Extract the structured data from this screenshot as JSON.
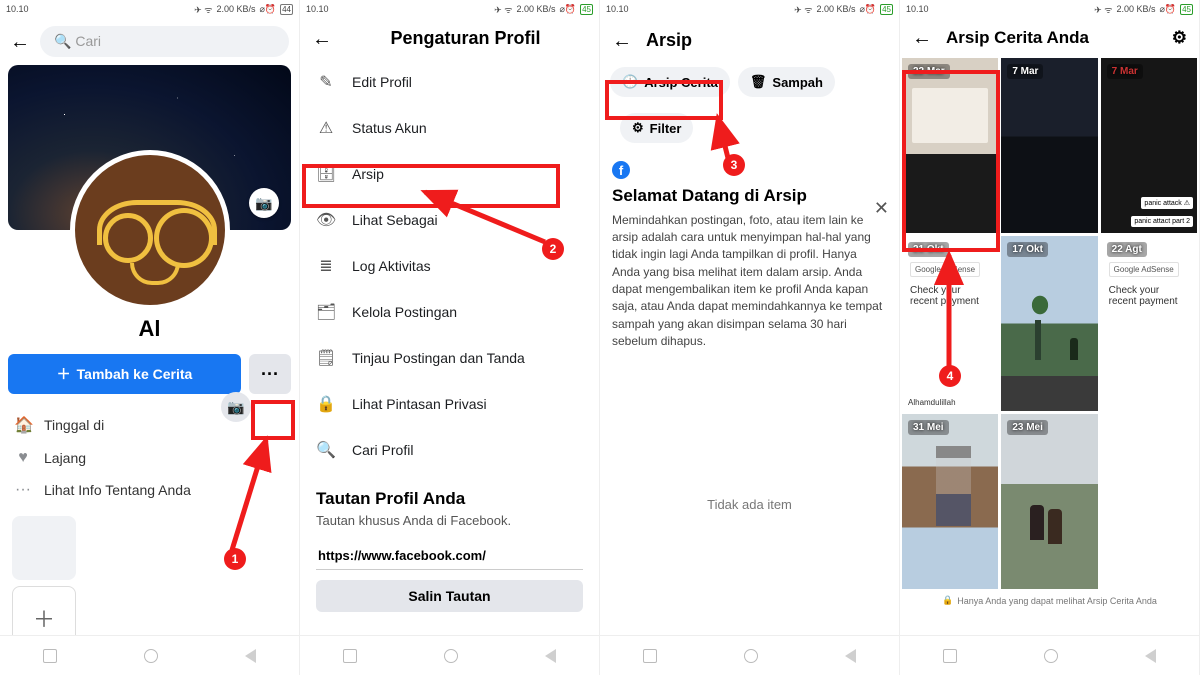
{
  "status": {
    "time": "10.10",
    "battery_p1": "44",
    "battery": "45",
    "net": "2.00 KB/s"
  },
  "panel1": {
    "search_placeholder": "Cari",
    "username": "Al",
    "add_story": "Tambah ke Cerita",
    "info": {
      "lives": "Tinggal di",
      "relation": "Lajang",
      "about": "Lihat Info Tentang Anda"
    }
  },
  "panel2": {
    "title": "Pengaturan Profil",
    "items": {
      "edit": "Edit Profil",
      "status": "Status Akun",
      "archive": "Arsip",
      "viewas": "Lihat Sebagai",
      "activity": "Log Aktivitas",
      "manage": "Kelola Postingan",
      "review": "Tinjau Postingan dan Tanda",
      "privacy": "Lihat Pintasan Privasi",
      "search": "Cari Profil"
    },
    "link_section": {
      "heading": "Tautan Profil Anda",
      "sub": "Tautan khusus Anda di Facebook.",
      "url": "https://www.facebook.com/",
      "copy": "Salin Tautan"
    }
  },
  "panel3": {
    "title": "Arsip",
    "chip_story": "Arsip Cerita",
    "chip_trash": "Sampah",
    "chip_filter": "Filter",
    "welcome_title": "Selamat Datang di Arsip",
    "welcome_body": "Memindahkan postingan, foto, atau item lain ke arsip adalah cara untuk menyimpan hal-hal yang tidak ingin lagi Anda tampilkan di profil. Hanya Anda yang bisa melihat item dalam arsip. Anda dapat mengembalikan item ke profil Anda kapan saja, atau Anda dapat memindahkannya ke tempat sampah yang akan disimpan selama 30 hari sebelum dihapus.",
    "no_item": "Tidak ada item"
  },
  "panel4": {
    "title": "Arsip Cerita Anda",
    "dates": [
      "22 Mar",
      "7 Mar",
      "7 Mar",
      "21 Okt",
      "17 Okt",
      "22 Agt",
      "31 Mei",
      "23 Mei"
    ],
    "card_text": {
      "adsense": "Google AdSense",
      "payment": "Check your recent payment",
      "panic": "panic attack ⚠",
      "panic2": "panic attact part 2",
      "alh": "Alhamdulillah"
    },
    "privacy_note": "Hanya Anda yang dapat melihat Arsip Cerita Anda"
  },
  "annotations": {
    "n1": "1",
    "n2": "2",
    "n3": "3",
    "n4": "4"
  }
}
